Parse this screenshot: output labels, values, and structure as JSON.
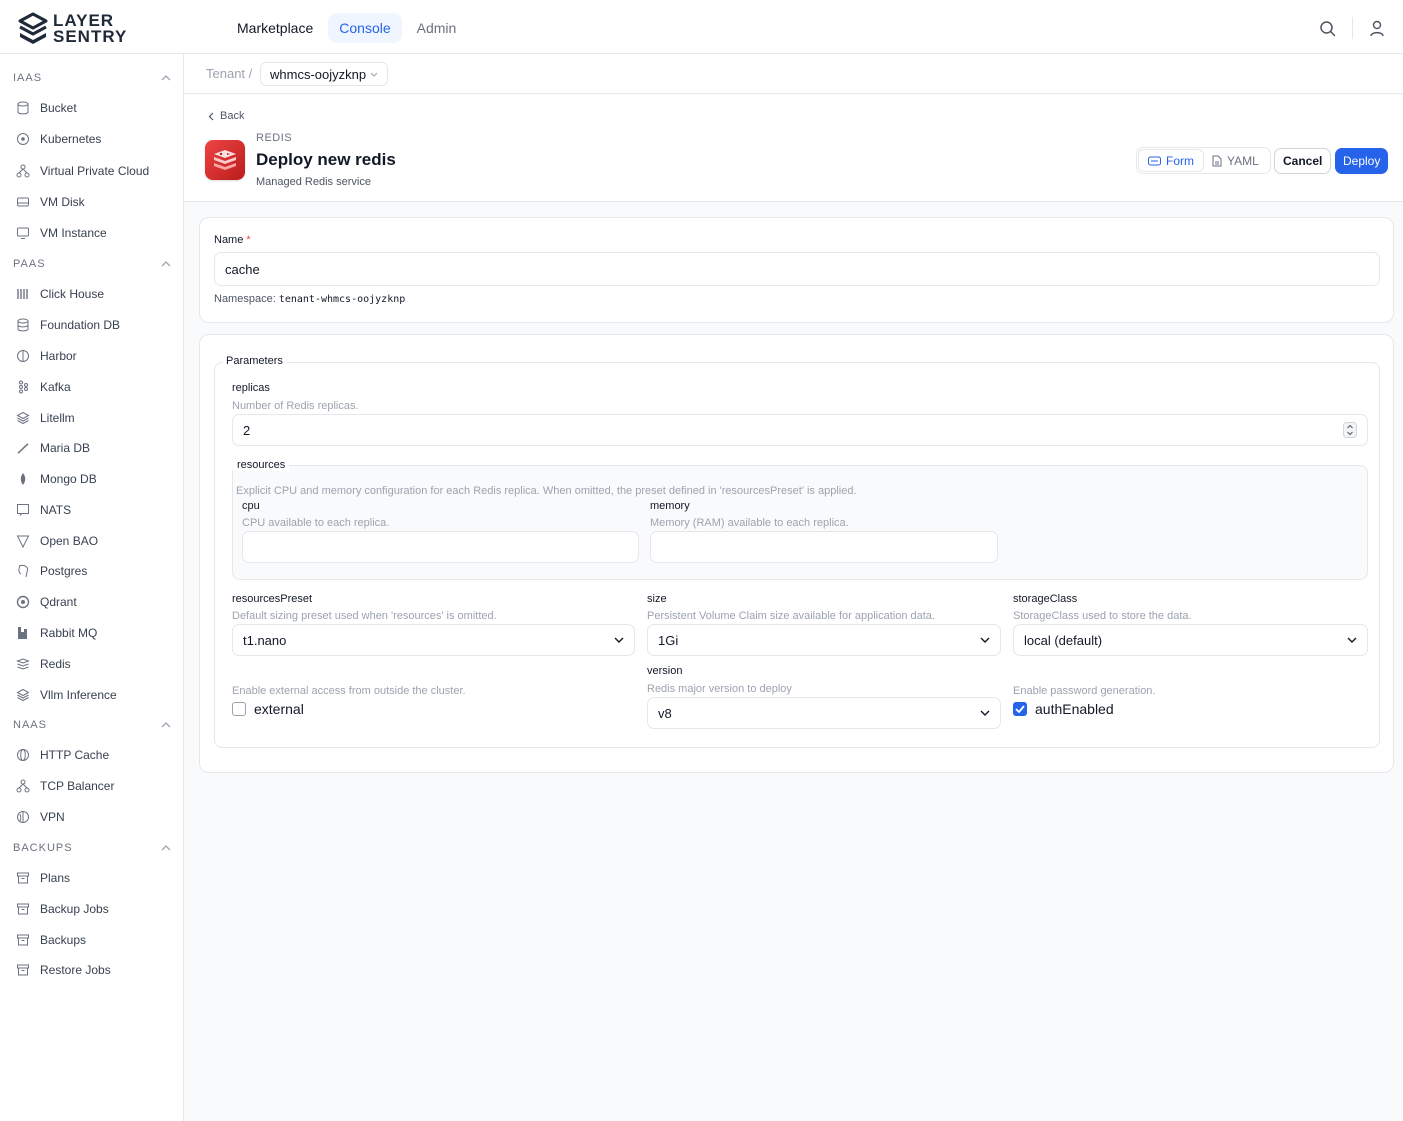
{
  "brand": {
    "line1": "LAYER",
    "line2": "SENTRY"
  },
  "topnav": {
    "marketplace": "Marketplace",
    "console": "Console",
    "admin": "Admin"
  },
  "sidebar": {
    "sections": [
      {
        "title": "IAAS",
        "items": [
          "Bucket",
          "Kubernetes",
          "Virtual Private Cloud",
          "VM Disk",
          "VM Instance"
        ]
      },
      {
        "title": "PAAS",
        "items": [
          "Click House",
          "Foundation DB",
          "Harbor",
          "Kafka",
          "Litellm",
          "Maria DB",
          "Mongo DB",
          "NATS",
          "Open BAO",
          "Postgres",
          "Qdrant",
          "Rabbit MQ",
          "Redis",
          "Vllm Inference"
        ]
      },
      {
        "title": "NAAS",
        "items": [
          "HTTP Cache",
          "TCP Balancer",
          "VPN"
        ]
      },
      {
        "title": "BACKUPS",
        "items": [
          "Plans",
          "Backup Jobs",
          "Backups",
          "Restore Jobs"
        ]
      }
    ]
  },
  "breadcrumb": {
    "tenant": "Tenant",
    "separator": "/",
    "current": "whmcs-oojyzknp"
  },
  "header": {
    "back": "Back",
    "kicker": "REDIS",
    "title": "Deploy new redis",
    "subtitle": "Managed Redis service",
    "form_tab": "Form",
    "yaml_tab": "YAML",
    "cancel": "Cancel",
    "deploy": "Deploy"
  },
  "name_card": {
    "label": "Name",
    "required": "*",
    "value": "cache",
    "namespace_label": "Namespace:",
    "namespace_value": "tenant-whmcs-oojyzknp"
  },
  "params": {
    "legend": "Parameters",
    "replicas": {
      "label": "replicas",
      "help": "Number of Redis replicas.",
      "value": "2"
    },
    "resources": {
      "legend": "resources",
      "help": "Explicit CPU and memory configuration for each Redis replica. When omitted, the preset defined in 'resourcesPreset' is applied.",
      "cpu": {
        "label": "cpu",
        "help": "CPU available to each replica.",
        "value": ""
      },
      "memory": {
        "label": "memory",
        "help": "Memory (RAM) available to each replica.",
        "value": ""
      }
    },
    "resourcesPreset": {
      "label": "resourcesPreset",
      "help": "Default sizing preset used when 'resources' is omitted.",
      "value": "t1.nano"
    },
    "size": {
      "label": "size",
      "help": "Persistent Volume Claim size available for application data.",
      "value": "1Gi"
    },
    "storageClass": {
      "label": "storageClass",
      "help": "StorageClass used to store the data.",
      "value": "local (default)"
    },
    "version": {
      "label": "version",
      "help": "Redis major version to deploy",
      "value": "v8"
    },
    "external": {
      "help": "Enable external access from outside the cluster.",
      "label": "external",
      "checked": false
    },
    "authEnabled": {
      "help": "Enable password generation.",
      "label": "authEnabled",
      "checked": true
    }
  }
}
